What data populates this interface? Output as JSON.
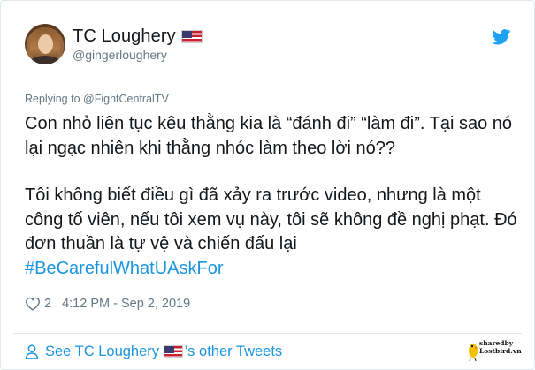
{
  "author": {
    "display_name": "TC Loughery",
    "handle": "@gingerloughery",
    "flag_icon": "us-flag-icon"
  },
  "reply": {
    "prefix": "Replying to",
    "to_handle": "@FightCentralTV"
  },
  "tweet": {
    "paragraph_1": "Con nhỏ liên tục kêu thằng kia là “đánh đi” “làm đi”. Tại sao nó lại ngạc nhiên khi thằng nhóc làm theo lời nó??",
    "paragraph_2": "Tôi không biết điều gì đã xảy ra trước video, nhưng là một công tố viên, nếu tôi xem vụ này, tôi sẽ không đề nghị phạt. Đó đơn thuần là tự vệ và chiến đấu lại",
    "hashtag": "#BeCarefulWhatUAskFor"
  },
  "meta": {
    "likes": "2",
    "timestamp": "4:12 PM - Sep 2, 2019"
  },
  "footer": {
    "prefix": "See TC Loughery",
    "suffix": "'s other Tweets"
  },
  "watermark": {
    "line1": "sharedby",
    "line2": "Lostbird.vn"
  },
  "colors": {
    "twitter_blue": "#1da1f2",
    "link_blue": "#1b95e0",
    "muted_gray": "#657786",
    "text": "#14171a",
    "border": "#e1e8ed"
  }
}
